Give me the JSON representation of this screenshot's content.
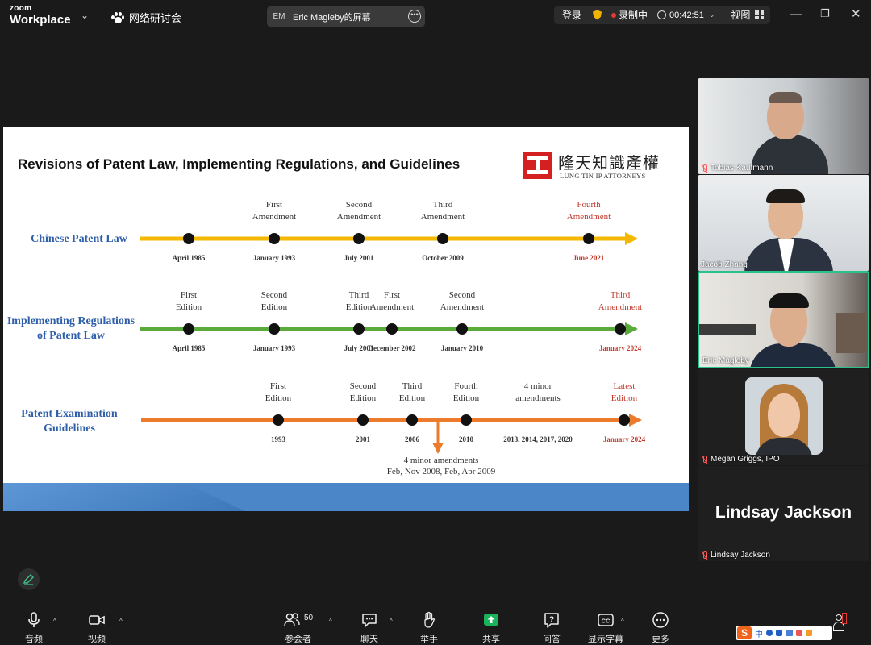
{
  "app": {
    "brand_small": "zoom",
    "brand_big": "Workplace",
    "webinar_label": "网络研讨会"
  },
  "share_indicator": {
    "initials": "EM",
    "text": "Eric Magleby的屏幕",
    "more_icon": "ellipsis-icon"
  },
  "status": {
    "login": "登录",
    "recording": "录制中",
    "timer": "00:42:51",
    "view": "视图"
  },
  "slide": {
    "title": "Revisions of Patent Law, Implementing Regulations, and Guidelines",
    "logo_cn": "隆天知識產權",
    "logo_en": "LUNG TIN IP ATTORNEYS",
    "colors": {
      "law": "#f5b800",
      "regs": "#5aab3a",
      "guidelines": "#ec7b2c",
      "highlight": "#c0392b",
      "heading": "#2f5fa8"
    },
    "timelines": [
      {
        "label": [
          "Chinese Patent Law"
        ],
        "events": [
          {
            "top": [],
            "date": "April 1985"
          },
          {
            "top": [
              "First",
              "Amendment"
            ],
            "date": "January 1993"
          },
          {
            "top": [
              "Second",
              "Amendment"
            ],
            "date": "July 2001"
          },
          {
            "top": [
              "Third",
              "Amendment"
            ],
            "date": "October 2009"
          },
          {
            "top": [
              "Fourth",
              "Amendment"
            ],
            "date": "June 2021",
            "highlight": true
          }
        ]
      },
      {
        "label": [
          "Implementing Regulations",
          "of Patent Law"
        ],
        "events": [
          {
            "top": [
              "First",
              "Edition"
            ],
            "date": "April 1985"
          },
          {
            "top": [
              "Second",
              "Edition"
            ],
            "date": "January 1993"
          },
          {
            "top": [
              "Third",
              "Edition"
            ],
            "date": "July 2001"
          },
          {
            "top": [
              "First",
              "Amendment"
            ],
            "date": "December 2002"
          },
          {
            "top": [
              "Second",
              "Amendment"
            ],
            "date": "January 2010"
          },
          {
            "top": [
              "Third",
              "Amendment"
            ],
            "date": "January 2024",
            "highlight": true
          }
        ]
      },
      {
        "label": [
          "Patent Examination",
          "Guidelines"
        ],
        "events": [
          {
            "top": [
              "First",
              "Edition"
            ],
            "date": "1993"
          },
          {
            "top": [
              "Second",
              "Edition"
            ],
            "date": "2001"
          },
          {
            "top": [
              "Third",
              "Edition"
            ],
            "date": "2006"
          },
          {
            "top": [
              "Fourth",
              "Edition"
            ],
            "date": "2010"
          },
          {
            "top": [
              "4 minor",
              "amendments"
            ],
            "date": "2013, 2014, 2017, 2020",
            "no_dot": true
          },
          {
            "top": [
              "Latest",
              "Edition"
            ],
            "date": "January 2024",
            "highlight": true
          }
        ],
        "callout": [
          "4 minor amendments",
          "Feb, Nov 2008, Feb, Apr 2009"
        ]
      }
    ]
  },
  "participants": [
    {
      "name": "Tobias Kaufmann",
      "muted": true
    },
    {
      "name": "Jacob Zhang",
      "muted": false
    },
    {
      "name": "Eric Magleby",
      "muted": false,
      "active": true
    },
    {
      "name": "Megan Griggs, IPO",
      "muted": true
    },
    {
      "name": "Lindsay Jackson",
      "muted": true,
      "display_name": "Lindsay Jackson"
    }
  ],
  "toolbar": {
    "audio": "音频",
    "video": "视频",
    "participants": "参会者",
    "participant_count": "50",
    "chat": "聊天",
    "raise_hand": "举手",
    "share": "共享",
    "qa": "问答",
    "captions": "显示字幕",
    "more": "更多",
    "ime_indicator": "中"
  }
}
